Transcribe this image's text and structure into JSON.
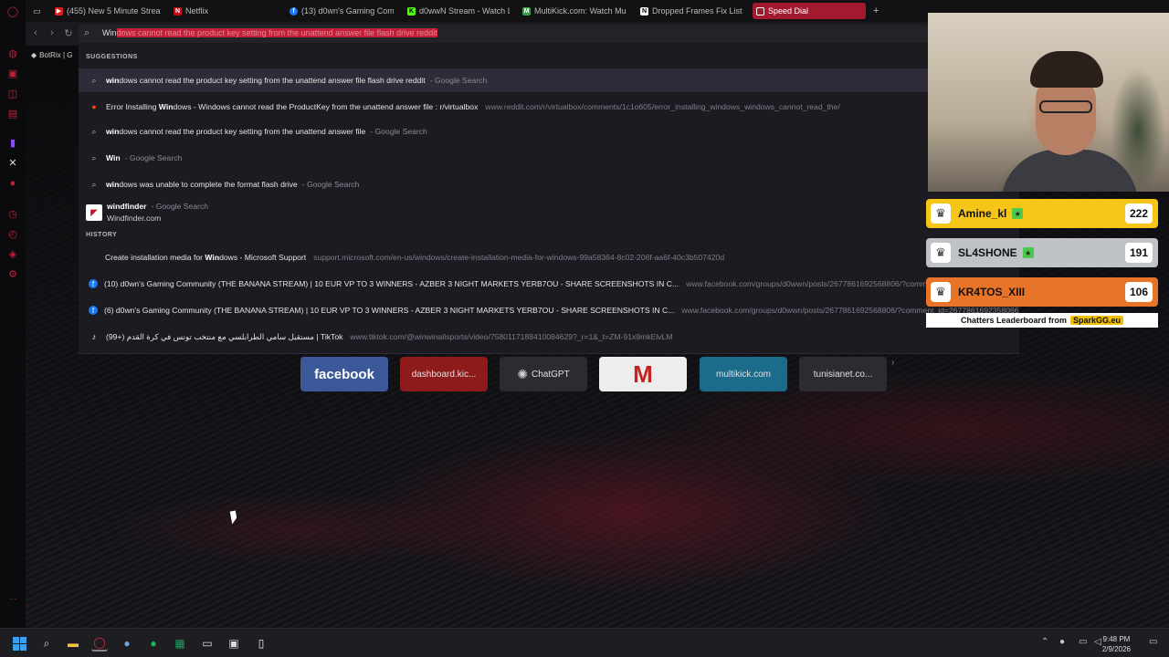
{
  "tabs": [
    {
      "label": "(455) New 5 Minute Strea",
      "icon": "youtube-icon",
      "color": "#e01b1b"
    },
    {
      "label": "Netflix",
      "icon": "netflix-icon",
      "color": "#c20d18"
    },
    {
      "label": "(13) d0wn's Gaming Comr",
      "icon": "facebook-icon",
      "color": "#1877f2"
    },
    {
      "label": "d0wwN Stream - Watch L",
      "icon": "kick-icon",
      "color": "#53fc18"
    },
    {
      "label": "MultiKick.com: Watch Mu",
      "icon": "multikick-icon",
      "color": "#2ea043"
    },
    {
      "label": "Dropped Frames Fix List",
      "icon": "notion-icon",
      "color": "#ffffff"
    },
    {
      "label": "Speed Dial",
      "icon": "speed-dial-icon",
      "color": "#a31a2e"
    }
  ],
  "address_bar": {
    "typed": "Win",
    "autocomplete": "dows cannot read the product key setting from the unattend answer file flash drive reddit"
  },
  "bookmark_bar": {
    "label": "BotRix | G"
  },
  "dropdown": {
    "suggestions_label": "SUGGESTIONS",
    "history_label": "HISTORY",
    "suggestions": [
      {
        "bold": "win",
        "text": "dows cannot read the product key setting from the unattend answer file flash drive reddit",
        "sub": "- Google Search",
        "url": "",
        "icon": "search-icon"
      },
      {
        "pre": "Error Installing ",
        "bold": "Win",
        "text": "dows - Windows cannot read the ProductKey from the unattend answer file : r/virtualbox",
        "sub": "",
        "url": "www.reddit.com/r/virtualbox/comments/1c1o605/error_installing_windows_windows_cannot_read_the/",
        "icon": "reddit-icon"
      },
      {
        "bold": "win",
        "text": "dows cannot read the product key setting from the unattend answer file",
        "sub": "- Google Search",
        "url": "",
        "icon": "search-icon"
      },
      {
        "bold": "Win",
        "text": "",
        "sub": "- Google Search",
        "url": "",
        "icon": "search-icon"
      },
      {
        "bold": "win",
        "text": "dows was unable to complete the format flash drive",
        "sub": "- Google Search",
        "url": "",
        "icon": "search-icon"
      },
      {
        "bold": "windfinder",
        "text": "",
        "sub": "- Google Search",
        "url": "Windfinder.com",
        "icon": "windfinder-icon"
      }
    ],
    "history": [
      {
        "pre": "Create installation media for ",
        "bold": "Win",
        "text": "dows - Microsoft Support",
        "url": "support.microsoft.com/en-us/windows/create-installation-media-for-windows-99a58364-8c02-206f-aa6f-40c3b507420d",
        "icon": "microsoft-icon"
      },
      {
        "pre": "",
        "bold": "",
        "text": "(10) d0wn's Gaming Community (THE BANANA STREAM) | 10 EUR VP TO 3 WINNERS - AZBER 3 NIGHT MARKETS YERB7OU - SHARE SCREENSHOTS IN C...",
        "url": "www.facebook.com/groups/d0wwn/posts/2677861692568806/?comment_id=",
        "icon": "facebook-icon"
      },
      {
        "pre": "",
        "bold": "",
        "text": "(6) d0wn's Gaming Community (THE BANANA STREAM) | 10 EUR VP TO 3 WINNERS - AZBER 3 NIGHT MARKETS YERB7OU - SHARE SCREENSHOTS IN C...",
        "url": "www.facebook.com/groups/d0wwn/posts/2677861692568806/?comment_id=2677861692358066",
        "icon": "facebook-icon"
      },
      {
        "pre": "",
        "bold": "",
        "text": "(99+) مستقبل سامي الطرابلسي مع منتخب تونس في كرة القدم | TikTok",
        "url": "www.tiktok.com/@winwinallsports/video/7580117188410084629?_r=1&_t=ZM-91x9mkElvLM",
        "icon": "tiktok-icon"
      }
    ]
  },
  "speed_dial": [
    {
      "label": "facebook",
      "bg": "#3b5998",
      "color": "#ffffff"
    },
    {
      "label": "dashboard.kic...",
      "bg": "#8e1b1b",
      "color": "#ddd"
    },
    {
      "label": "ChatGPT",
      "bg": "#2b2b30",
      "color": "#eee"
    },
    {
      "label": "",
      "bg": "#ededed",
      "color": "#c5221f"
    },
    {
      "label": "multikick.com",
      "bg": "#1b6b8a",
      "color": "#eee"
    },
    {
      "label": "tunisianet.co...",
      "bg": "#2b2b30",
      "color": "#ddd"
    }
  ],
  "leaderboard": {
    "entries": [
      {
        "name": "Amine_kl",
        "score": "222",
        "bg": "#f5c518",
        "star": true
      },
      {
        "name": "SL4SHONE",
        "score": "191",
        "bg": "#bfc3c8",
        "star": true
      },
      {
        "name": "KR4TOS_XIII",
        "score": "106",
        "bg": "#e8742a",
        "star": false
      }
    ],
    "footer_text": "Chatters Leaderboard from",
    "footer_brand": "SparkGG.eu"
  },
  "taskbar": {
    "time": "9:48 PM",
    "date": "2/9/2026"
  }
}
